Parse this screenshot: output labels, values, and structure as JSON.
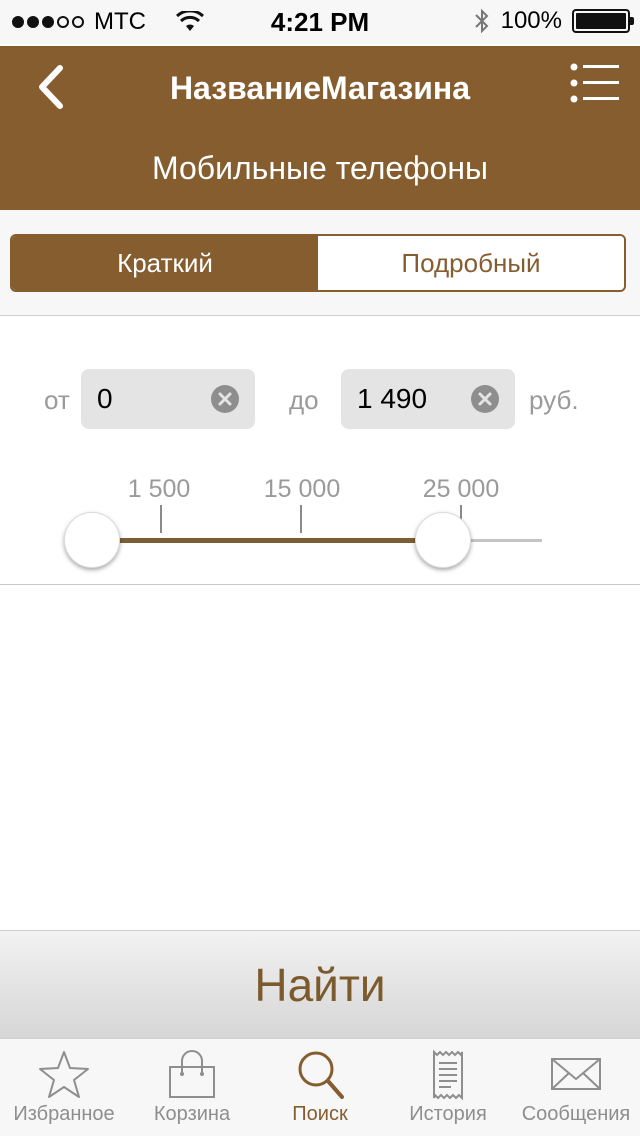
{
  "status_bar": {
    "carrier": "MTC",
    "time": "4:21 PM",
    "battery": "100%",
    "signal_strength": 3,
    "signal_max": 5,
    "battery_level": 1.0
  },
  "header": {
    "title": "НазваниеМагазина",
    "category": "Мобильные телефоны"
  },
  "view_toggle": {
    "brief": "Краткий",
    "detailed": "Подробный",
    "selected": "brief"
  },
  "price_filter": {
    "from_label": "от",
    "from_value": "0",
    "to_label": "до",
    "to_value": "1 490",
    "currency": "руб.",
    "ticks": [
      "1 500",
      "15 000",
      "25 000"
    ],
    "range_low_fraction": 0.0,
    "range_high_fraction": 0.78
  },
  "find_button": {
    "label": "Найти"
  },
  "tab_bar": {
    "items": [
      {
        "label": "Избранное",
        "icon": "star-icon"
      },
      {
        "label": "Корзина",
        "icon": "bag-icon"
      },
      {
        "label": "Поиск",
        "icon": "search-icon",
        "active": true
      },
      {
        "label": "История",
        "icon": "receipt-icon"
      },
      {
        "label": "Сообщения",
        "icon": "envelope-icon"
      }
    ]
  },
  "colors": {
    "brand": "#855d2f",
    "status_bar_bg": "#f7f7f7",
    "field_bg": "#e4e4e4",
    "muted_text": "#9a9a9a"
  }
}
